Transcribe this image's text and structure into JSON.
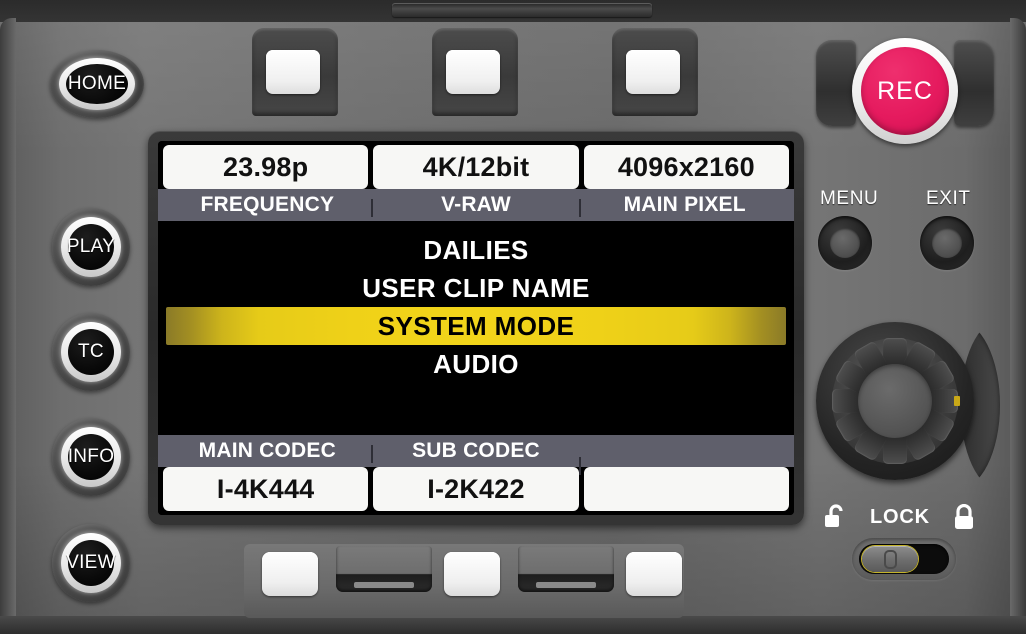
{
  "device": {
    "name": "camera-control-panel"
  },
  "left_buttons": [
    {
      "label": "HOME",
      "name": "home-button",
      "shape": "oval"
    },
    {
      "label": "PLAY",
      "name": "play-button",
      "shape": "round"
    },
    {
      "label": "TC",
      "name": "tc-button",
      "shape": "round"
    },
    {
      "label": "INFO",
      "name": "info-button",
      "shape": "round"
    },
    {
      "label": "VIEW",
      "name": "view-button",
      "shape": "round"
    }
  ],
  "record": {
    "label": "REC",
    "color": "#e51a5e"
  },
  "right_buttons": [
    {
      "label": "MENU",
      "name": "menu-button"
    },
    {
      "label": "EXIT",
      "name": "exit-button"
    }
  ],
  "lock": {
    "label": "LOCK",
    "state": "unlocked",
    "unlocked_icon": "unlock-icon",
    "locked_icon": "lock-icon"
  },
  "jog_dial": {
    "name": "jog-dial",
    "teeth": 12,
    "marker_color": "#c9a817"
  },
  "soft_keys": {
    "top": [
      {
        "name": "top-soft-key-1"
      },
      {
        "name": "top-soft-key-2"
      },
      {
        "name": "top-soft-key-3"
      }
    ],
    "bottom": [
      {
        "name": "bottom-soft-key-1"
      },
      {
        "name": "bottom-soft-key-2"
      },
      {
        "name": "bottom-soft-key-3"
      }
    ]
  },
  "screen": {
    "status_top": {
      "values": [
        "23.98p",
        "4K/12bit",
        "4096x2160"
      ],
      "labels": [
        "FREQUENCY",
        "V-RAW",
        "MAIN PIXEL"
      ]
    },
    "menu": {
      "items": [
        {
          "label": "DAILIES",
          "selected": false
        },
        {
          "label": "USER CLIP NAME",
          "selected": false
        },
        {
          "label": "SYSTEM MODE",
          "selected": true
        },
        {
          "label": "AUDIO",
          "selected": false
        }
      ],
      "highlight_color": "#efd118",
      "highlight_edge_color": "#8a7a28"
    },
    "status_bottom": {
      "labels": [
        "MAIN CODEC",
        "SUB CODEC",
        ""
      ],
      "values": [
        "I-4K444",
        "I-2K422",
        ""
      ]
    }
  }
}
